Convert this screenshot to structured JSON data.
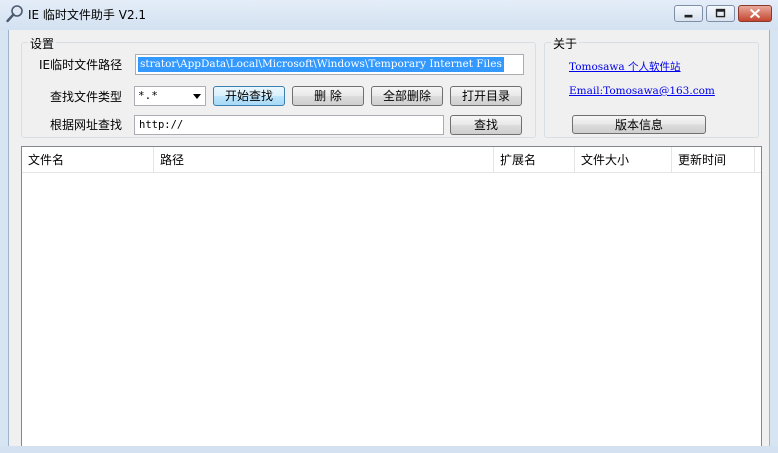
{
  "window": {
    "title": "IE 临时文件助手 V2.1",
    "icon": "magnifier-icon"
  },
  "settings": {
    "group_label": "设置",
    "path_label": "IE临时文件路径",
    "path_value": "strator\\AppData\\Local\\Microsoft\\Windows\\Temporary Internet Files",
    "type_label": "查找文件类型",
    "type_value": "*.*",
    "start_search_button": "开始查找",
    "delete_button": "删  除",
    "delete_all_button": "全部删除",
    "open_dir_button": "打开目录",
    "url_label": "根据网址查找",
    "url_value": "http://",
    "find_button": "查找"
  },
  "about": {
    "group_label": "关于",
    "site_link": "Tomosawa 个人软件站",
    "email_link": "Email:Tomosawa@163.com",
    "version_button": "版本信息"
  },
  "file_list": {
    "columns": [
      "文件名",
      "路径",
      "扩展名",
      "文件大小",
      "更新时间"
    ],
    "rows": []
  },
  "colors": {
    "selection": "#3399ff",
    "link": "#0000ee",
    "titlebar": "#d3e1f1"
  }
}
